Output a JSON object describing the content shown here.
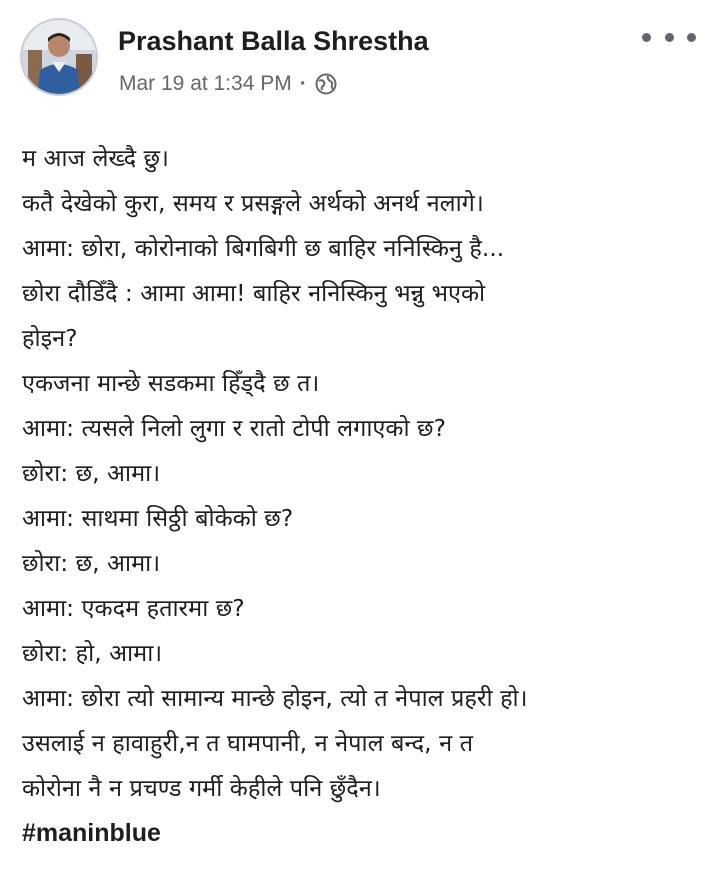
{
  "post": {
    "author": "Prashant Balla Shrestha",
    "timestamp": "Mar 19 at 1:34 PM",
    "separator": "·",
    "privacy_icon": "globe-icon",
    "more_icon": "more-horizontal-icon",
    "lines": [
      "म आज लेख्दै छु।",
      "कतै देखेको कुरा, समय र प्रसङ्गले अर्थको अनर्थ नलागे।",
      "आमा: छोरा, कोरोनाको बिगबिगी छ बाहिर ननिस्किनु है...",
      "छोरा दौडिँदै : आमा आमा! बाहिर ननिस्किनु भन्नु भएको",
      "होइन?",
      "एकजना मान्छे सडकमा हिँड्दै छ त।",
      "आमा: त्यसले निलो लुगा र रातो टोपी लगाएको छ?",
      "छोरा: छ, आमा।",
      "आमा: साथमा सिठ्ठी बोकेको छ?",
      "छोरा: छ, आमा।",
      "आमा: एकदम हतारमा छ?",
      "छोरा: हो, आमा।",
      "आमा: छोरा त्यो सामान्य मान्छे होइन, त्यो त नेपाल प्रहरी हो।",
      "उसलाई न हावाहुरी,न त घामपानी, न नेपाल बन्द, न त",
      "कोरोना नै न प्रचण्ड गर्मी केहीले पनि छुँदैन।"
    ],
    "hashtag": "#maninblue"
  },
  "colors": {
    "text": "#1c1e21",
    "meta": "#65676b",
    "icon": "#606770",
    "background": "#ffffff"
  }
}
